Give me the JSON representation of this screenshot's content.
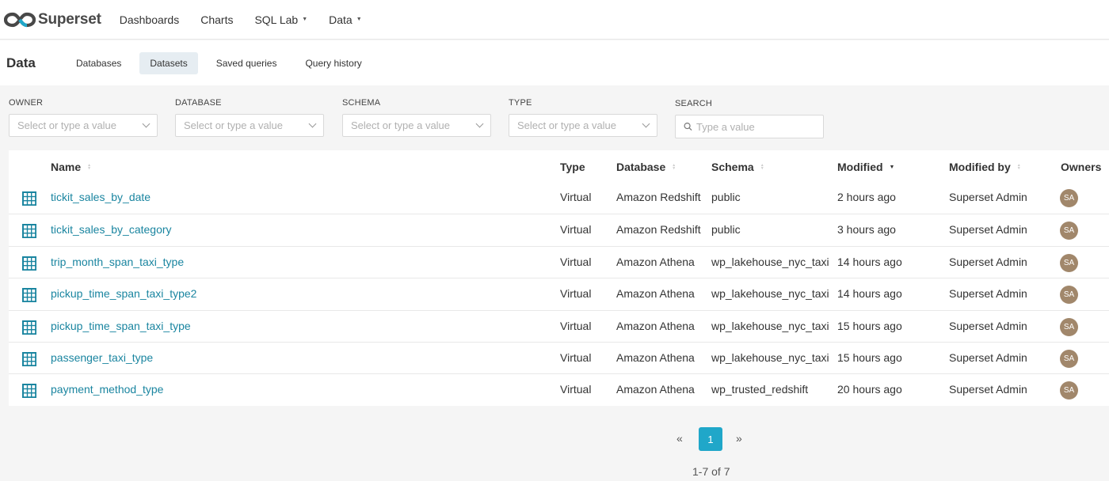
{
  "navbar": {
    "brand": "Superset",
    "links": [
      {
        "label": "Dashboards",
        "dropdown": false
      },
      {
        "label": "Charts",
        "dropdown": false
      },
      {
        "label": "SQL Lab",
        "dropdown": true
      },
      {
        "label": "Data",
        "dropdown": true
      }
    ]
  },
  "subheader": {
    "title": "Data",
    "tabs": [
      "Databases",
      "Datasets",
      "Saved queries",
      "Query history"
    ],
    "active_tab": "Datasets"
  },
  "filters": {
    "owner": {
      "label": "OWNER",
      "placeholder": "Select or type a value"
    },
    "database": {
      "label": "DATABASE",
      "placeholder": "Select or type a value"
    },
    "schema": {
      "label": "SCHEMA",
      "placeholder": "Select or type a value"
    },
    "type": {
      "label": "TYPE",
      "placeholder": "Select or type a value"
    },
    "search": {
      "label": "SEARCH",
      "placeholder": "Type a value"
    }
  },
  "table": {
    "columns": [
      "Name",
      "Type",
      "Database",
      "Schema",
      "Modified",
      "Modified by",
      "Owners"
    ],
    "rows": [
      {
        "name": "tickit_sales_by_date",
        "type": "Virtual",
        "database": "Amazon Redshift",
        "schema": "public",
        "modified": "2 hours ago",
        "modified_by": "Superset Admin",
        "owner": "SA"
      },
      {
        "name": "tickit_sales_by_category",
        "type": "Virtual",
        "database": "Amazon Redshift",
        "schema": "public",
        "modified": "3 hours ago",
        "modified_by": "Superset Admin",
        "owner": "SA"
      },
      {
        "name": "trip_month_span_taxi_type",
        "type": "Virtual",
        "database": "Amazon Athena",
        "schema": "wp_lakehouse_nyc_taxi",
        "modified": "14 hours ago",
        "modified_by": "Superset Admin",
        "owner": "SA"
      },
      {
        "name": "pickup_time_span_taxi_type2",
        "type": "Virtual",
        "database": "Amazon Athena",
        "schema": "wp_lakehouse_nyc_taxi",
        "modified": "14 hours ago",
        "modified_by": "Superset Admin",
        "owner": "SA"
      },
      {
        "name": "pickup_time_span_taxi_type",
        "type": "Virtual",
        "database": "Amazon Athena",
        "schema": "wp_lakehouse_nyc_taxi",
        "modified": "15 hours ago",
        "modified_by": "Superset Admin",
        "owner": "SA"
      },
      {
        "name": "passenger_taxi_type",
        "type": "Virtual",
        "database": "Amazon Athena",
        "schema": "wp_lakehouse_nyc_taxi",
        "modified": "15 hours ago",
        "modified_by": "Superset Admin",
        "owner": "SA"
      },
      {
        "name": "payment_method_type",
        "type": "Virtual",
        "database": "Amazon Athena",
        "schema": "wp_trusted_redshift",
        "modified": "20 hours ago",
        "modified_by": "Superset Admin",
        "owner": "SA"
      }
    ]
  },
  "pagination": {
    "prev": "«",
    "current_page": "1",
    "next": "»",
    "summary": "1-7 of 7"
  },
  "colors": {
    "accent": "#20a7c9",
    "link": "#1a85a0",
    "avatar": "#a1876b"
  }
}
